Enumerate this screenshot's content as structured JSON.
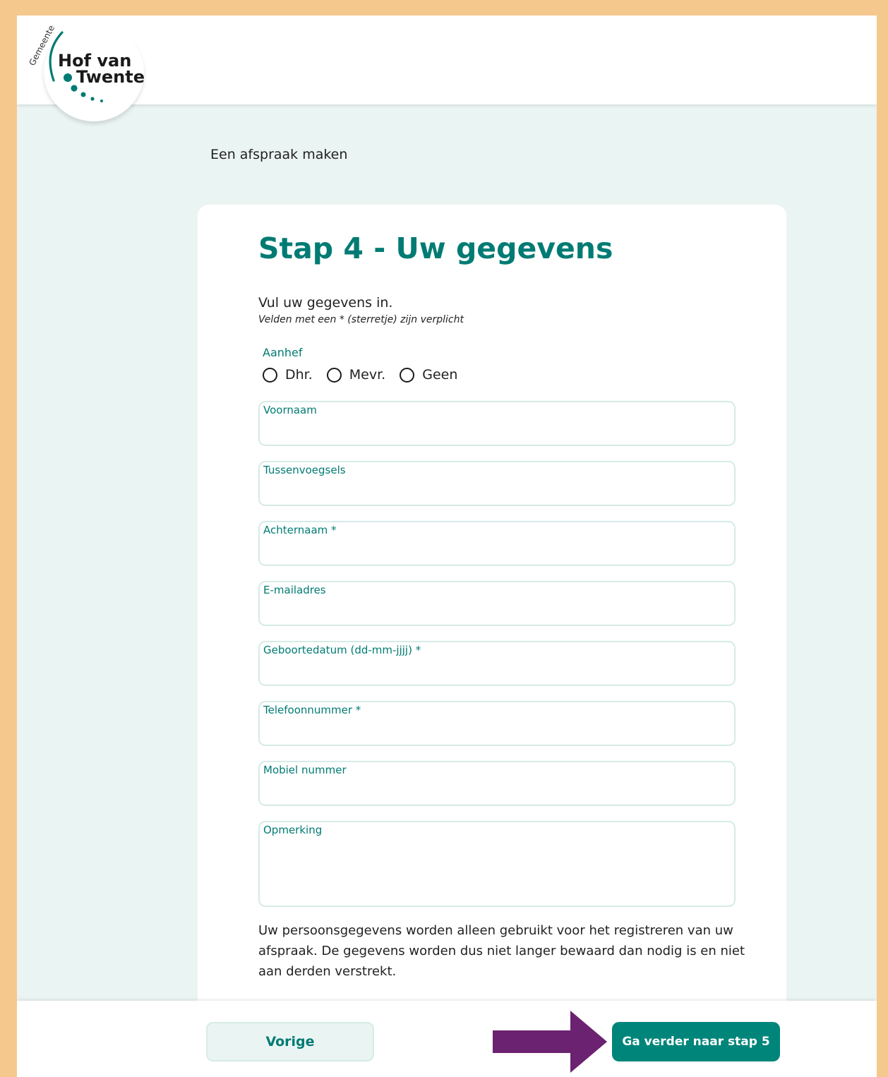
{
  "logo": {
    "line_small": "Gemeente",
    "line1": "Hof van",
    "line2": "Twente",
    "brand_color": "#007b73"
  },
  "breadcrumb": "Een afspraak maken",
  "form": {
    "title": "Stap 4 - Uw gegevens",
    "intro": "Vul uw gegevens in.",
    "required_note": "Velden met een * (sterretje) zijn verplicht",
    "salutation": {
      "label": "Aanhef",
      "options": [
        "Dhr.",
        "Mevr.",
        "Geen"
      ],
      "selected": null
    },
    "fields": [
      {
        "label": "Voornaam",
        "value": ""
      },
      {
        "label": "Tussenvoegsels",
        "value": ""
      },
      {
        "label": "Achternaam *",
        "value": ""
      },
      {
        "label": "E-mailadres",
        "value": ""
      },
      {
        "label": "Geboortedatum (dd-mm-jjjj) *",
        "value": ""
      },
      {
        "label": "Telefoonnummer *",
        "value": ""
      },
      {
        "label": "Mobiel nummer",
        "value": ""
      },
      {
        "label": "Opmerking",
        "value": ""
      }
    ],
    "privacy_text": "Uw persoonsgegevens worden alleen gebruikt voor het registreren van uw afspraak. De gegevens worden dus niet langer bewaard dan nodig is en niet aan derden verstrekt."
  },
  "footer": {
    "prev_label": "Vorige",
    "next_label": "Ga verder naar stap 5"
  },
  "annotation": {
    "arrow_color": "#6b2270",
    "arrow_icon": "arrow-right-icon"
  },
  "colors": {
    "accent": "#007b73",
    "button_primary": "#00857a",
    "page_bg": "#eaf4f2",
    "frame_border": "#f5c88e"
  }
}
